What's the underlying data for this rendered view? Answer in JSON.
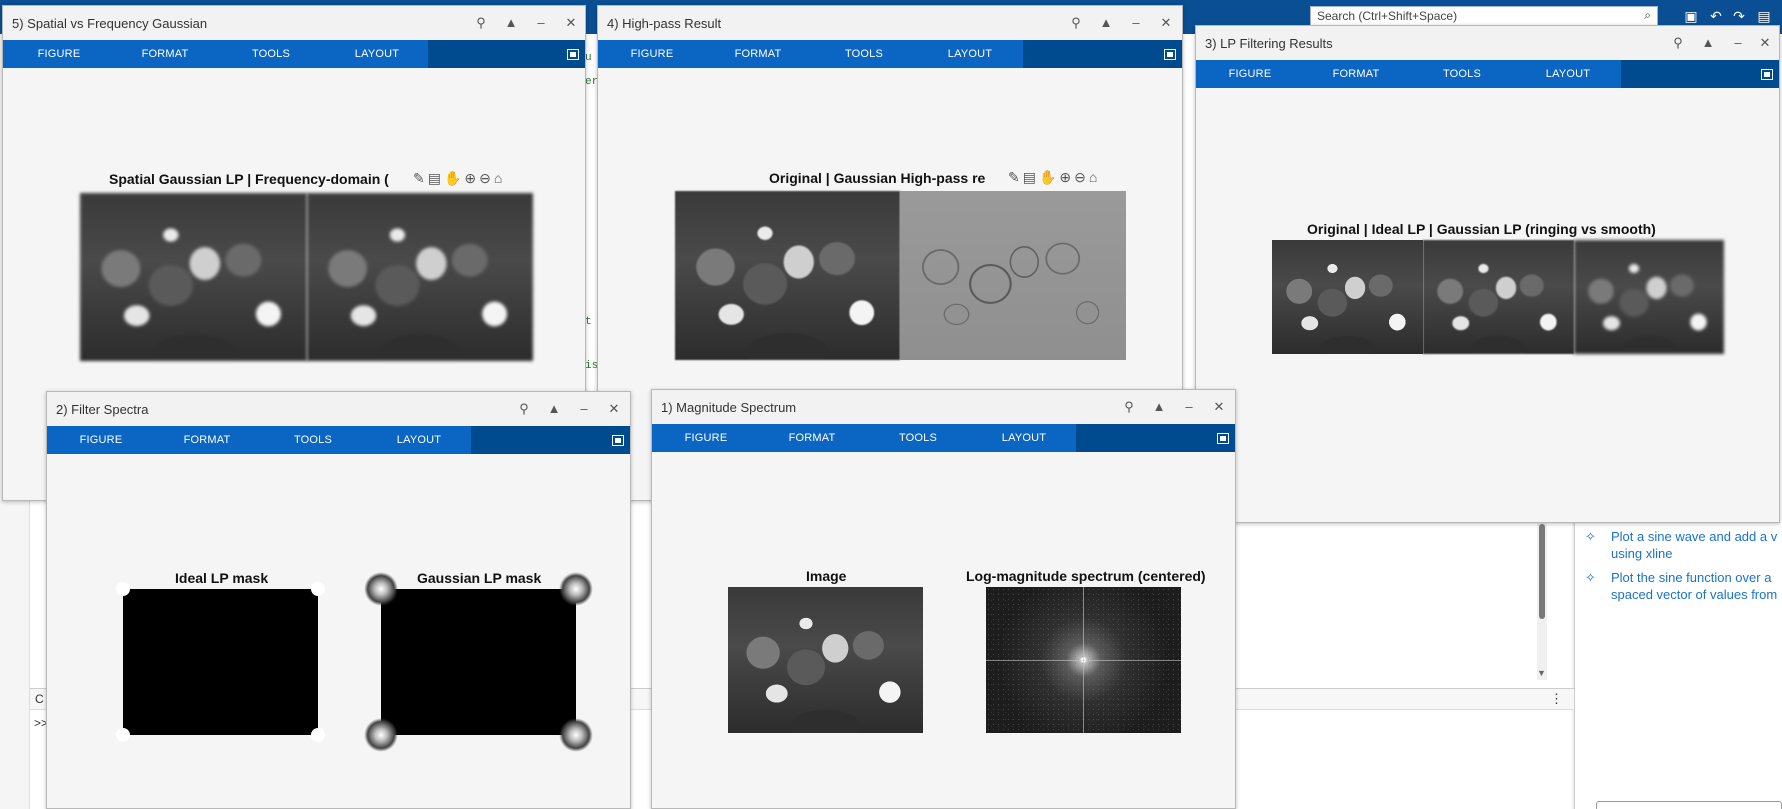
{
  "desktop": {
    "search_placeholder": "Search (Ctrl+Shift+Space)",
    "cmd_bar_label": "C",
    "cmd_prompt": ">>",
    "suggestions": [
      {
        "line1": "Plot a sine wave and add a v",
        "line2": "using xline"
      },
      {
        "line1": "Plot the sine function over a",
        "line2": "spaced vector of values from"
      }
    ],
    "bg_fragments": [
      "u",
      "er",
      "t",
      "is"
    ]
  },
  "figure_toolbar": {
    "tabs": [
      "FIGURE",
      "FORMAT",
      "TOOLS",
      "LAYOUT"
    ]
  },
  "figures": {
    "spatial": {
      "title": "5) Spatial vs Frequency Gaussian",
      "axes_title": "Spatial Gaussian LP | Frequency-domain (",
      "panel_count": 2
    },
    "highpass": {
      "title": "4) High-pass Result",
      "axes_title": "Original | Gaussian High-pass re",
      "panel_count": 2
    },
    "lp": {
      "title": "3) LP Filtering Results",
      "axes_title": "Original | Ideal LP | Gaussian LP (ringing vs smooth)",
      "panel_count": 3
    },
    "spectra": {
      "title": "2) Filter Spectra",
      "ideal_title": "Ideal LP mask",
      "gauss_title": "Gaussian LP mask"
    },
    "magnitude": {
      "title": "1) Magnitude Spectrum",
      "image_title": "Image",
      "spectrum_title": "Log-magnitude spectrum (centered)"
    }
  },
  "icons": {
    "window_controls": [
      "pin-icon",
      "maximize-icon",
      "minimize-icon",
      "close-icon"
    ],
    "axes_toolbar": [
      "brush-icon",
      "data-tips-icon",
      "pan-icon",
      "zoom-in-icon",
      "zoom-out-icon",
      "home-icon"
    ]
  },
  "colors": {
    "toolbar_dark": "#004a8f",
    "toolbar_blue": "#0a66c2",
    "desktop_bar": "#0a4f93",
    "suggestion": "#1a73c7"
  }
}
